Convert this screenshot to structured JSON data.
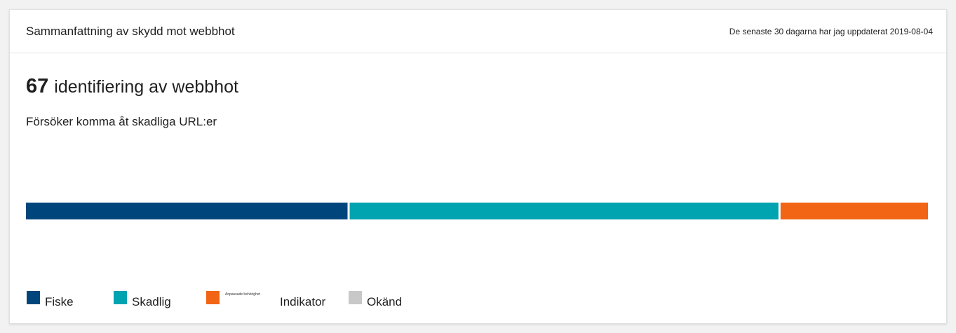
{
  "card": {
    "title": "Sammanfattning av skydd mot webbhot",
    "updated": "De senaste 30 dagarna har jag uppdaterat 2019-08-04"
  },
  "summary": {
    "count": "67",
    "count_label": "identifiering av webbhot",
    "subtitle": "Försöker komma åt skadliga URL:er"
  },
  "chart_data": {
    "type": "bar",
    "orientation": "horizontal-stacked",
    "categories": [
      "Fiske",
      "Skadlig",
      "Indikator",
      "Okänd"
    ],
    "values": [
      24,
      32,
      11,
      0
    ],
    "total": 67,
    "colors": [
      "#00467d",
      "#00a3b0",
      "#f26514",
      "#c8c8c8"
    ]
  },
  "legend": {
    "items": [
      {
        "label": "Fiske",
        "color": "#00467d"
      },
      {
        "label": "Skadlig",
        "color": "#00a3b0"
      },
      {
        "label": "Indikator",
        "prefix": "Anpassade behörighet",
        "color": "#f26514"
      },
      {
        "label": "Okänd",
        "color": "#c8c8c8"
      }
    ]
  }
}
